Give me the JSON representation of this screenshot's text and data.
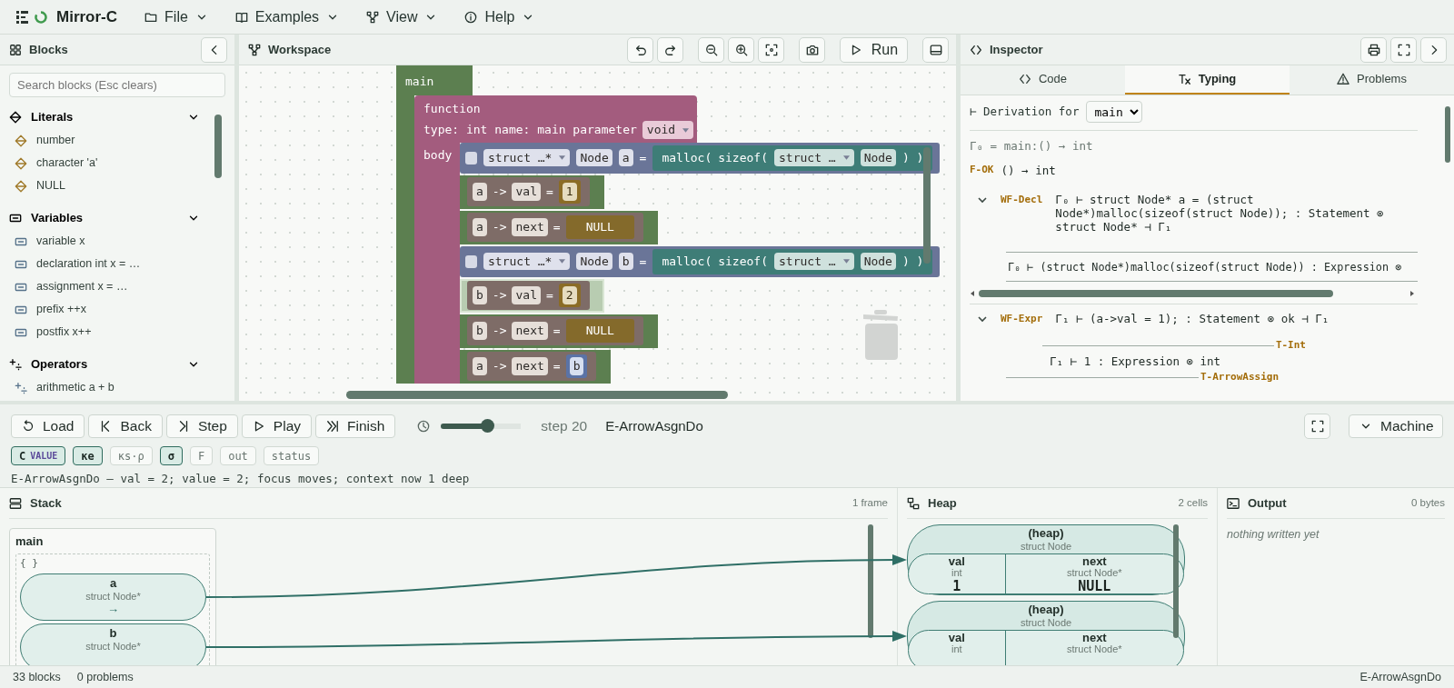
{
  "app": {
    "title": "Mirror-C"
  },
  "menu": [
    {
      "label": "File"
    },
    {
      "label": "Examples"
    },
    {
      "label": "View"
    },
    {
      "label": "Help"
    }
  ],
  "blocks_panel": {
    "title": "Blocks",
    "search": {
      "placeholder": "Search blocks (Esc clears)"
    },
    "categories": [
      {
        "label": "Literals",
        "expanded": true,
        "items": [
          "number",
          "character 'a'",
          "NULL"
        ]
      },
      {
        "label": "Variables",
        "expanded": true,
        "items": [
          "variable x",
          "declaration int x = …",
          "assignment x = …",
          "prefix ++x",
          "postfix x++"
        ]
      },
      {
        "label": "Operators",
        "expanded": true,
        "items": [
          "arithmetic a + b"
        ]
      }
    ]
  },
  "workspace": {
    "title": "Workspace",
    "run_label": "Run",
    "main_label": "main",
    "function": {
      "title": "function",
      "signature": "type: int name: main parameter",
      "parameter": "void",
      "body_label": "body"
    },
    "statements": [
      {
        "kind": "decl",
        "selected": false,
        "tokens": [
          {
            "kind": "dropdown",
            "text": "struct …*"
          },
          {
            "kind": "field",
            "text": "Node"
          },
          {
            "kind": "field",
            "text": "a"
          },
          {
            "kind": "label",
            "text": "="
          },
          {
            "kind": "expr",
            "tokens": [
              {
                "kind": "label",
                "text": "malloc("
              },
              {
                "kind": "label",
                "text": "sizeof("
              },
              {
                "kind": "dropdown",
                "text": "struct …"
              },
              {
                "kind": "field",
                "text": "Node"
              },
              {
                "kind": "label",
                "text": ") )"
              }
            ]
          }
        ]
      },
      {
        "kind": "assign",
        "selected": false,
        "tokens": [
          {
            "kind": "field",
            "text": "a"
          },
          {
            "kind": "label",
            "text": "->"
          },
          {
            "kind": "field",
            "text": "val"
          },
          {
            "kind": "label",
            "text": "="
          },
          {
            "kind": "number",
            "text": "1"
          }
        ]
      },
      {
        "kind": "assign",
        "selected": false,
        "tokens": [
          {
            "kind": "field",
            "text": "a"
          },
          {
            "kind": "label",
            "text": "->"
          },
          {
            "kind": "field",
            "text": "next"
          },
          {
            "kind": "label",
            "text": "="
          },
          {
            "kind": "null",
            "text": "NULL"
          }
        ]
      },
      {
        "kind": "decl",
        "selected": false,
        "tokens": [
          {
            "kind": "dropdown",
            "text": "struct …*"
          },
          {
            "kind": "field",
            "text": "Node"
          },
          {
            "kind": "field",
            "text": "b"
          },
          {
            "kind": "label",
            "text": "="
          },
          {
            "kind": "expr",
            "tokens": [
              {
                "kind": "label",
                "text": "malloc("
              },
              {
                "kind": "label",
                "text": "sizeof("
              },
              {
                "kind": "dropdown",
                "text": "struct …"
              },
              {
                "kind": "field",
                "text": "Node"
              },
              {
                "kind": "label",
                "text": ") )"
              }
            ]
          }
        ]
      },
      {
        "kind": "assign",
        "selected": true,
        "tokens": [
          {
            "kind": "field",
            "text": "b"
          },
          {
            "kind": "label",
            "text": "->"
          },
          {
            "kind": "field",
            "text": "val"
          },
          {
            "kind": "label",
            "text": "="
          },
          {
            "kind": "number",
            "text": "2"
          }
        ]
      },
      {
        "kind": "assign",
        "selected": false,
        "tokens": [
          {
            "kind": "field",
            "text": "b"
          },
          {
            "kind": "label",
            "text": "->"
          },
          {
            "kind": "field",
            "text": "next"
          },
          {
            "kind": "label",
            "text": "="
          },
          {
            "kind": "null",
            "text": "NULL"
          }
        ]
      },
      {
        "kind": "assign",
        "selected": false,
        "tokens": [
          {
            "kind": "field",
            "text": "a"
          },
          {
            "kind": "label",
            "text": "->"
          },
          {
            "kind": "field",
            "text": "next"
          },
          {
            "kind": "label",
            "text": "="
          },
          {
            "kind": "ref",
            "text": "b"
          }
        ]
      }
    ]
  },
  "inspector": {
    "title": "Inspector",
    "tabs": [
      {
        "label": "Code",
        "selected": false
      },
      {
        "label": "Typing",
        "selected": true
      },
      {
        "label": "Problems",
        "selected": false
      }
    ],
    "derivation_label": "⊢ Derivation for",
    "function_select": "main",
    "context": "Γ₀ = main:() → int",
    "root": {
      "rule": "F-OK",
      "judgment": "() → int"
    },
    "rules": [
      {
        "rule": "WF-Decl",
        "expanded": true,
        "judgment": "Γ₀ ⊢ struct Node* a = (struct Node*)malloc(sizeof(struct Node)); : Statement ⊗ struct Node* ⊣ Γ₁",
        "premises": [
          {
            "kind": "boxed",
            "judgment": "Γ₀ ⊢ (struct Node*)malloc(sizeof(struct Node)) : Expression ⊗"
          }
        ]
      },
      {
        "rule": "WF-Expr",
        "expanded": true,
        "judgment": "Γ₁ ⊢ (a->val = 1); : Statement ⊗ ok ⊣ Γ₁",
        "premises": [
          {
            "kind": "inference",
            "rule": "T-Int",
            "judgment": "Γ₁ ⊢ 1 : Expression ⊗ int",
            "below_rule": "T-ArrowAssign"
          }
        ]
      }
    ]
  },
  "controls": {
    "buttons": [
      {
        "label": "Load"
      },
      {
        "label": "Back"
      },
      {
        "label": "Step"
      },
      {
        "label": "Play"
      },
      {
        "label": "Finish"
      }
    ],
    "speed": {
      "level": 0.58
    },
    "step": "step 20",
    "rule": "E-ArrowAsgnDo",
    "machine_label": "Machine"
  },
  "chips": [
    {
      "label": "C",
      "sub": "VALUE",
      "on": true
    },
    {
      "label": "κe",
      "on": true
    },
    {
      "label": "κs·ρ",
      "on": false
    },
    {
      "label": "σ",
      "on": true
    },
    {
      "label": "F",
      "on": false
    },
    {
      "label": "out",
      "on": false
    },
    {
      "label": "status",
      "on": false
    }
  ],
  "description": "E-ArrowAsgnDo — val = 2; value = 2; focus moves; context now 1 deep",
  "stack": {
    "title": "Stack",
    "count": "1 frame",
    "frames": [
      {
        "name": "main",
        "scope": "{ }",
        "vars": [
          {
            "name": "a",
            "type": "struct Node*",
            "value": "→",
            "pointer": true
          },
          {
            "name": "b",
            "type": "struct Node*",
            "pointer": true
          }
        ]
      }
    ]
  },
  "heap": {
    "title": "Heap",
    "count": "2 cells",
    "cells": [
      {
        "title": "(heap)",
        "type": "struct Node",
        "fields": [
          {
            "name": "val",
            "type": "int",
            "value": "1"
          },
          {
            "name": "next",
            "type": "struct Node*",
            "value": "NULL"
          }
        ]
      },
      {
        "title": "(heap)",
        "type": "struct Node",
        "fields": [
          {
            "name": "val",
            "type": "int"
          },
          {
            "name": "next",
            "type": "struct Node*"
          }
        ]
      }
    ]
  },
  "output": {
    "title": "Output",
    "count": "0 bytes",
    "empty_text": "nothing written yet"
  },
  "status_bar": {
    "blocks": "33 blocks",
    "problems": "0 problems",
    "rule": "E-ArrowAsgnDo"
  }
}
